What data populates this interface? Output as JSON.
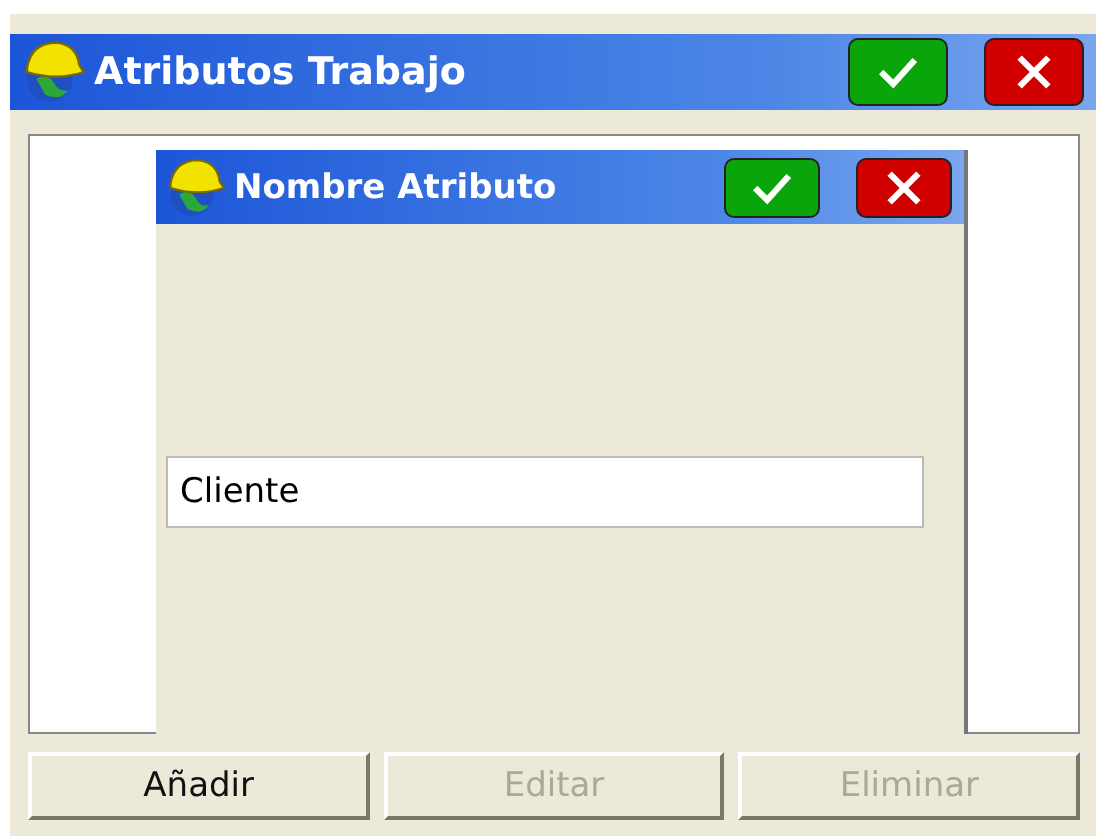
{
  "window": {
    "title": "Atributos Trabajo"
  },
  "dialog": {
    "title": "Nombre Atributo",
    "field": {
      "value": "Cliente"
    }
  },
  "buttons": [
    {
      "label": "Añadir",
      "disabled": false
    },
    {
      "label": "Editar",
      "disabled": true
    },
    {
      "label": "Eliminar",
      "disabled": true
    }
  ]
}
